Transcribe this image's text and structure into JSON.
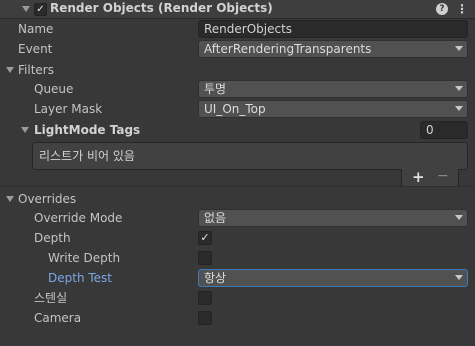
{
  "component": {
    "title": "Render Objects (Render Objects)",
    "enabled": true
  },
  "fields": {
    "name_label": "Name",
    "name_value": "RenderObjects",
    "event_label": "Event",
    "event_value": "AfterRenderingTransparents"
  },
  "filters": {
    "section_label": "Filters",
    "queue_label": "Queue",
    "queue_value": "투명",
    "layer_mask_label": "Layer Mask",
    "layer_mask_value": "UI_On_Top",
    "lightmode_label": "LightMode Tags",
    "lightmode_count": "0",
    "list_empty_text": "리스트가 비어 있음",
    "add_symbol": "+",
    "remove_symbol": "−"
  },
  "overrides": {
    "section_label": "Overrides",
    "override_mode_label": "Override Mode",
    "override_mode_value": "없음",
    "depth_label": "Depth",
    "depth_checked": true,
    "write_depth_label": "Write Depth",
    "write_depth_checked": false,
    "depth_test_label": "Depth Test",
    "depth_test_value": "항상",
    "stencil_label": "스텐실",
    "stencil_checked": false,
    "camera_label": "Camera",
    "camera_checked": false
  },
  "colors": {
    "background": "#383838",
    "accent_blue": "#7aa7e6",
    "focus_border": "#3a79bb"
  },
  "icons": {
    "help": "help-icon",
    "settings": "kebab-menu-icon",
    "foldout": "foldout-triangle-icon",
    "check": "check-icon"
  }
}
